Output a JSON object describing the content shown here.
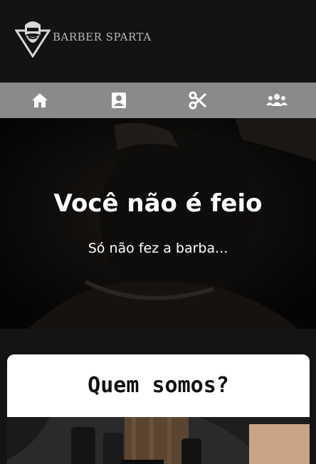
{
  "header": {
    "brand": "BARBER SPARTA",
    "logo_icon": "spartan-barber-logo-icon"
  },
  "nav": {
    "items": [
      {
        "icon": "home-icon"
      },
      {
        "icon": "contact-card-icon"
      },
      {
        "icon": "scissors-icon"
      },
      {
        "icon": "users-icon"
      }
    ]
  },
  "hero": {
    "title": "Você não é feio",
    "subtitle": "Só não fez a barba..."
  },
  "about": {
    "title": "Quem somos?"
  },
  "colors": {
    "header_bg": "#131313",
    "nav_bg": "#8a8a8a",
    "card_bg": "#ffffff",
    "text_light": "#ffffff"
  }
}
